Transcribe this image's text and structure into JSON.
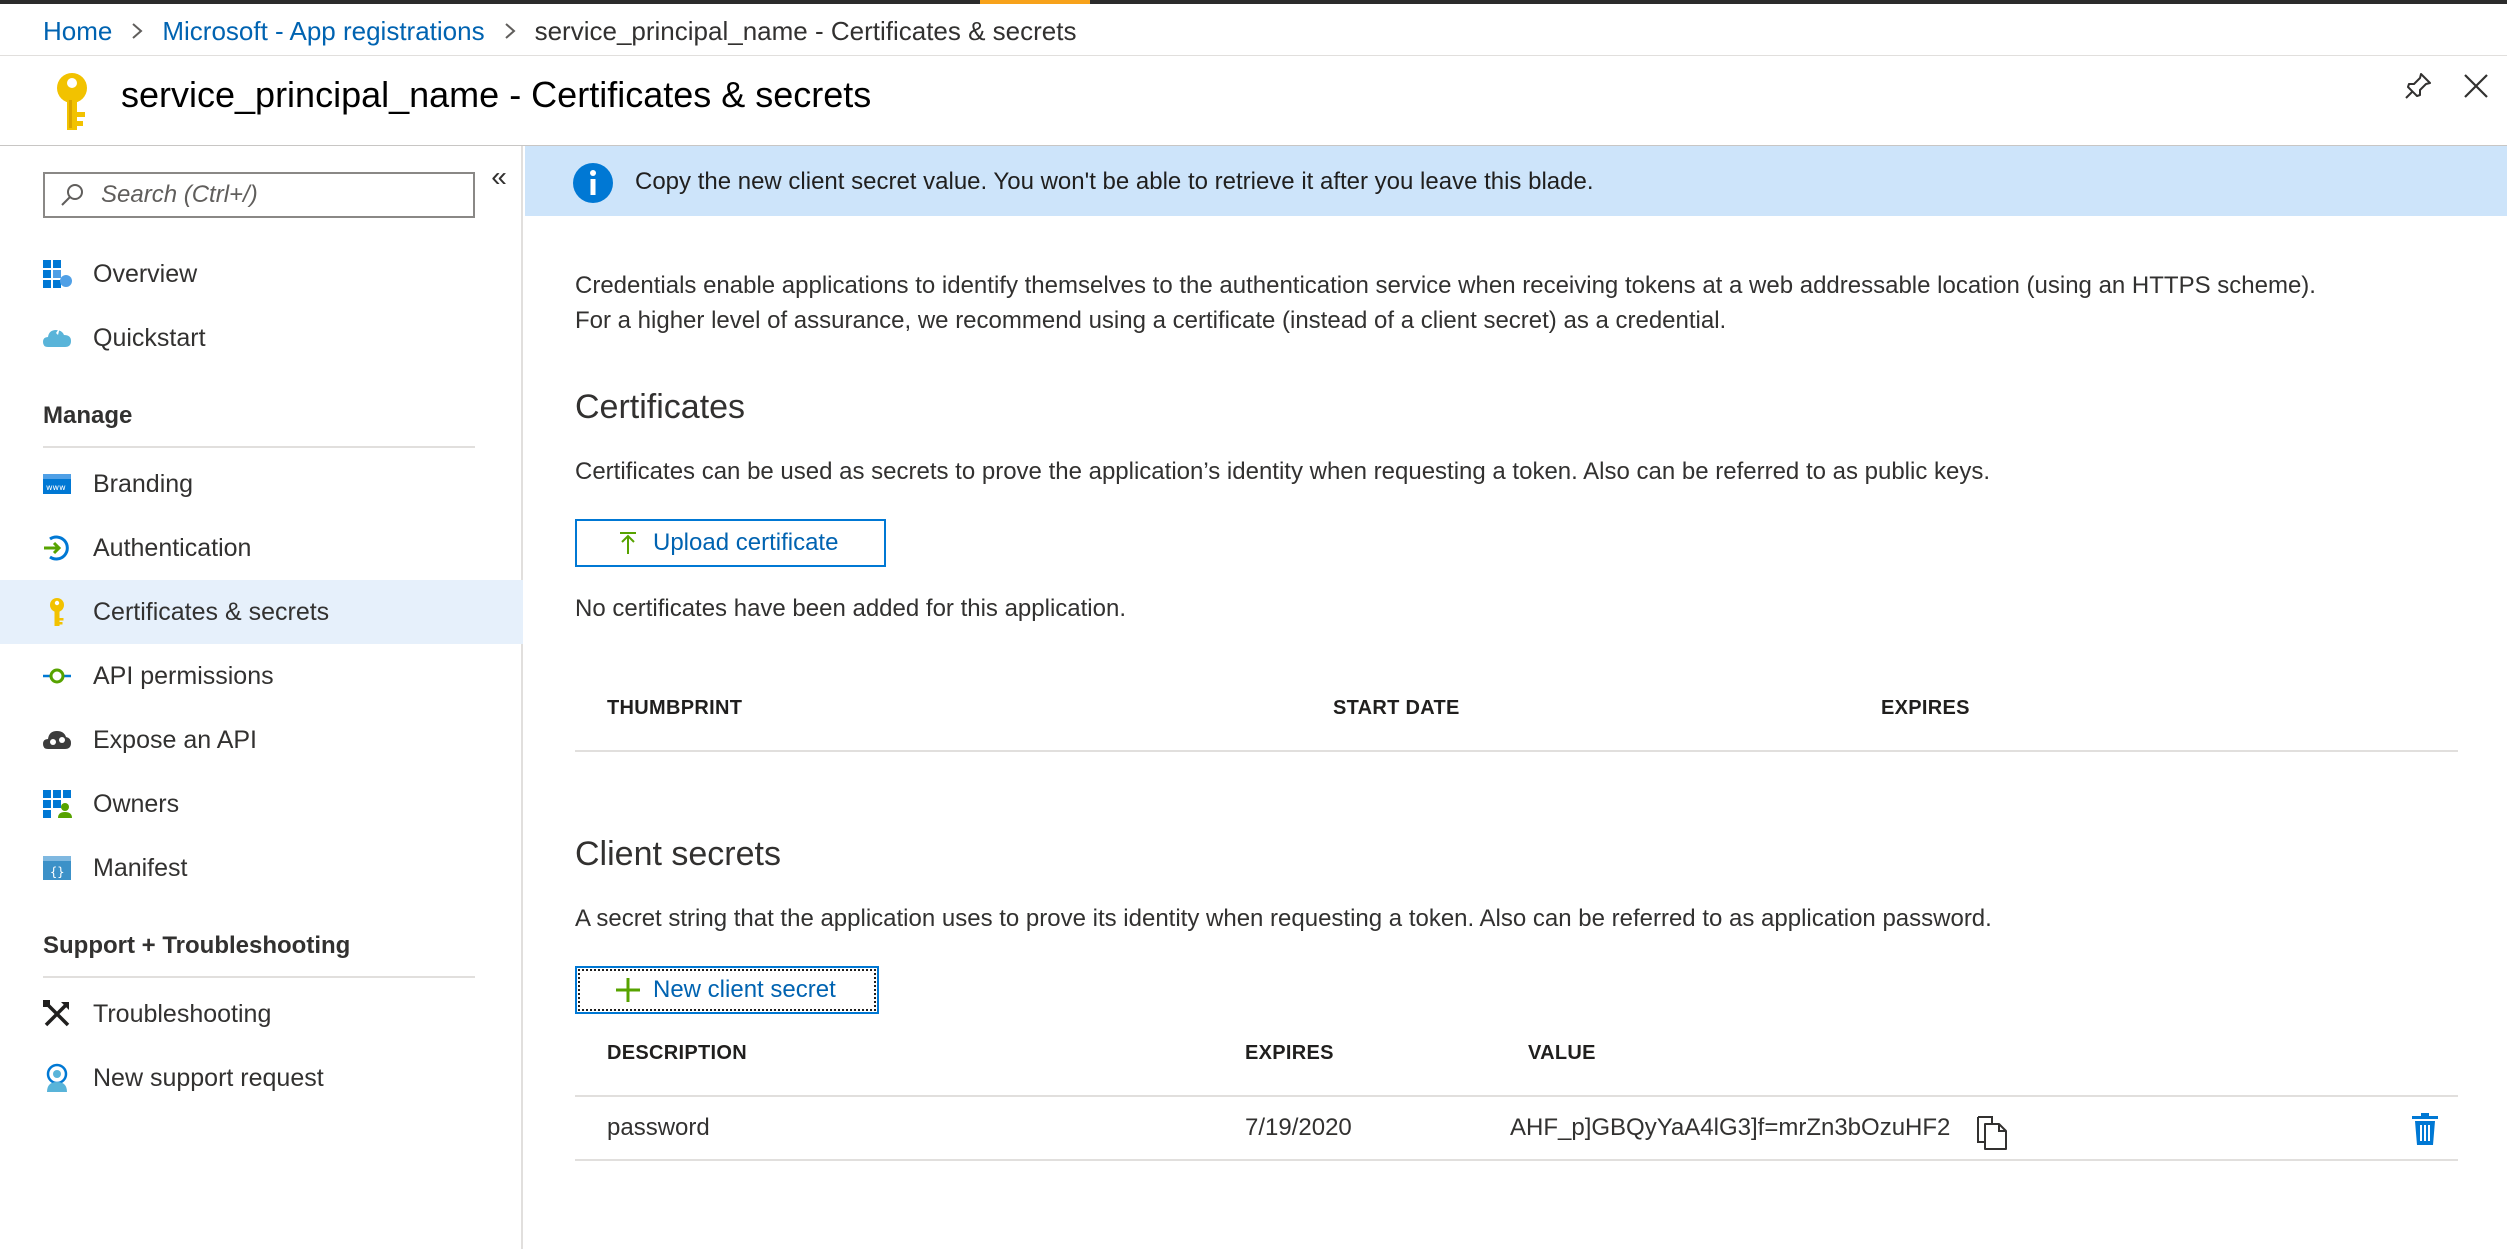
{
  "breadcrumb": {
    "home": "Home",
    "app_registrations": "Microsoft - App registrations",
    "current": "service_principal_name - Certificates & secrets",
    "separator": ">"
  },
  "header": {
    "title": "service_principal_name - Certificates & secrets",
    "icon": "key-icon",
    "pin_icon": "pin-icon",
    "close_icon": "close-icon"
  },
  "sidebar": {
    "search_placeholder": "Search (Ctrl+/)",
    "collapse_glyph": "«",
    "items_top": [
      {
        "label": "Overview",
        "icon": "overview-grid-icon"
      },
      {
        "label": "Quickstart",
        "icon": "quickstart-cloud-icon"
      }
    ],
    "manage_label": "Manage",
    "manage_items": [
      {
        "label": "Branding",
        "icon": "branding-icon"
      },
      {
        "label": "Authentication",
        "icon": "authentication-icon"
      },
      {
        "label": "Certificates & secrets",
        "icon": "key-icon",
        "selected": true
      },
      {
        "label": "API permissions",
        "icon": "api-permissions-icon"
      },
      {
        "label": "Expose an API",
        "icon": "expose-api-icon"
      },
      {
        "label": "Owners",
        "icon": "owners-icon"
      },
      {
        "label": "Manifest",
        "icon": "manifest-icon"
      }
    ],
    "support_label": "Support + Troubleshooting",
    "support_items": [
      {
        "label": "Troubleshooting",
        "icon": "troubleshooting-icon"
      },
      {
        "label": "New support request",
        "icon": "support-request-icon"
      }
    ]
  },
  "banner": {
    "text": "Copy the new client secret value. You won't be able to retrieve it after you leave this blade.",
    "icon": "info-icon"
  },
  "intro": {
    "line1": "Credentials enable applications to identify themselves to the authentication service when receiving tokens at a web addressable location (using an HTTPS scheme).",
    "line2": "For a higher level of assurance, we recommend using a certificate (instead of a client secret) as a credential."
  },
  "certificates": {
    "heading": "Certificates",
    "description": "Certificates can be used as secrets to prove the application’s identity when requesting a token. Also can be referred to as public keys.",
    "upload_label": "Upload certificate",
    "empty_text": "No certificates have been added for this application.",
    "columns": [
      "THUMBPRINT",
      "START DATE",
      "EXPIRES"
    ]
  },
  "client_secrets": {
    "heading": "Client secrets",
    "description": "A secret string that the application uses to prove its identity when requesting a token. Also can be referred to as application password.",
    "new_label": "New client secret",
    "columns": [
      "DESCRIPTION",
      "EXPIRES",
      "VALUE"
    ],
    "rows": [
      {
        "description": "password",
        "expires": "7/19/2020",
        "value": "AHF_p]GBQyYaA4lG3]f=mrZn3bOzuHF2"
      }
    ]
  },
  "colors": {
    "link": "#0063b1",
    "accent": "#0078d4",
    "banner_bg": "#cde4fa",
    "selected_bg": "#e6f0fb",
    "key_yellow": "#f2c200",
    "plus_green": "#57a300"
  }
}
